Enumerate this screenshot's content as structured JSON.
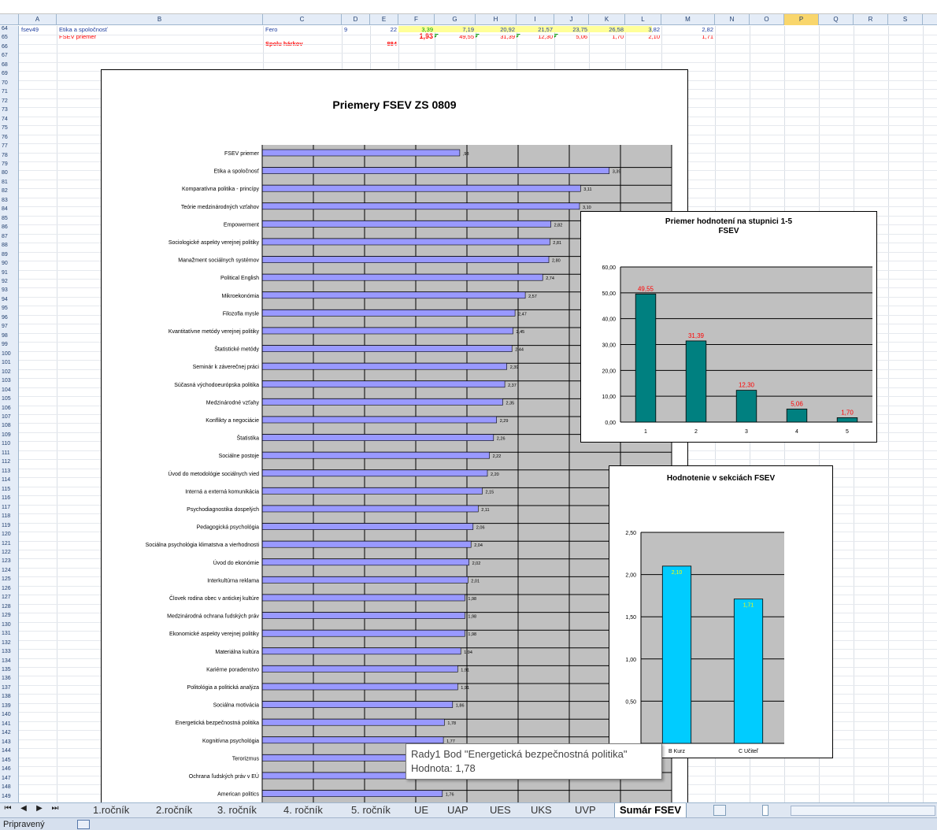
{
  "column_headers": [
    "A",
    "B",
    "C",
    "D",
    "E",
    "F",
    "G",
    "H",
    "I",
    "J",
    "K",
    "L",
    "M",
    "N",
    "O",
    "P",
    "Q",
    "R",
    "S"
  ],
  "selected_column": "P",
  "row_numbers": [
    "64",
    "65",
    "66",
    "67",
    "68",
    "69",
    "70",
    "71",
    "72",
    "73",
    "74",
    "75",
    "76",
    "77",
    "78",
    "79",
    "80",
    "81",
    "82",
    "83",
    "84",
    "85",
    "86",
    "87",
    "88",
    "89",
    "90",
    "91",
    "92",
    "93",
    "94",
    "95",
    "96",
    "97",
    "98",
    "99",
    "100",
    "101",
    "102",
    "103",
    "104",
    "105",
    "106",
    "107",
    "108",
    "109",
    "110",
    "111",
    "112",
    "113",
    "114",
    "115",
    "116",
    "117",
    "118",
    "119",
    "120",
    "121",
    "122",
    "123",
    "124",
    "125",
    "126",
    "127",
    "128",
    "129",
    "130",
    "131",
    "132",
    "133",
    "134",
    "135",
    "136",
    "137",
    "138",
    "139",
    "140",
    "141",
    "142",
    "143",
    "144",
    "145",
    "146",
    "147",
    "148",
    "149"
  ],
  "rows": {
    "r64": {
      "a": "fsev49",
      "b": "Etika a spoločnosť",
      "c": "Fero",
      "d": "9",
      "e": "22",
      "f": "3,39",
      "g": "7,19",
      "h": "20,92",
      "i": "21,57",
      "j": "23,75",
      "k": "26,58",
      "l": "3,82",
      "m": "2,82"
    },
    "r65": {
      "b": "FSEV priemer",
      "f": "1,93",
      "g": "49,55",
      "h": "31,39",
      "i": "12,30",
      "j": "5,06",
      "k": "1,70",
      "l": "2,10",
      "m": "1,71"
    },
    "r66": {
      "c": "Spolu hárkov",
      "e": "884"
    }
  },
  "charts": {
    "main": {
      "title": "Priemery FSEV ZS 0809",
      "chart_data": {
        "type": "bar",
        "orientation": "horizontal",
        "title": "Priemery FSEV ZS 0809",
        "categories": [
          "FSEV priemer",
          "Etika a spoločnosť",
          "Komparatívna politika - princípy",
          "Teórie medzinárodných vzťahov",
          "Empowerment",
          "Sociologické aspekty verejnej politiky",
          "Manažment sociálnych systémov",
          "Political English",
          "Mikroekonómia",
          "Filozofia mysle",
          "Kvantitatívne metódy verejnej politiky",
          "Štatistické metódy",
          "Seminár k záverečnej práci",
          "Súčasná východoeurópska politika",
          "Medzinárodné vzťahy",
          "Konflikty a negociácie",
          "Štatistika",
          "Sociálne postoje",
          "Úvod do metodológie sociálnych vied",
          "Interná a externá komunikácia",
          "Psychodiagnostika dospelých",
          "Pedagogická psychológia",
          "Sociálna psychológia klimatstva a vierhodnosti",
          "Úvod do ekonómie",
          "Interkultúrna reklama",
          "Človek rodina obec v antickej kultúre",
          "Medzinárodná ochrana ľudských práv",
          "Ekonomické aspekty verejnej politiky",
          "Materiálna kultúra",
          "Kariérne poradenstvo",
          "Politológia a politická analýza",
          "Sociálna motivácia",
          "Energetická bezpečnostná politika",
          "Kognitívna psychológia",
          "Terorizmus",
          "Ochrana ľudských práv v EÚ",
          "American politics"
        ],
        "values": [
          1.93,
          3.39,
          3.11,
          3.1,
          2.82,
          2.81,
          2.8,
          2.74,
          2.57,
          2.47,
          2.45,
          2.44,
          2.39,
          2.37,
          2.35,
          2.29,
          2.26,
          2.22,
          2.2,
          2.15,
          2.11,
          2.06,
          2.04,
          2.02,
          2.01,
          1.98,
          1.98,
          1.98,
          1.94,
          1.91,
          1.91,
          1.86,
          1.78,
          1.77,
          1.76,
          1.76,
          1.76
        ],
        "value_labels": [
          ",93",
          "3,39",
          "3,11",
          "3,10",
          "2,82",
          "2,81",
          "2,80",
          "2,74",
          "2,57",
          "2,47",
          "2,45",
          "2,44",
          "2,39",
          "2,37",
          "2,35",
          "2,29",
          "2,26",
          "2,22",
          "2,20",
          "2,15",
          "2,11",
          "2,06",
          "2,04",
          "2,02",
          "2,01",
          "1,98",
          "1,98",
          "1,98",
          "1,94",
          "1,91",
          "1,91",
          "1,86",
          "1,78",
          "1,77",
          "",
          "",
          "1,76"
        ],
        "xlim": [
          0,
          4
        ],
        "bar_color": "#9999ff",
        "plot_bg": "#c0c0c0",
        "grid": true
      }
    },
    "grades": {
      "title_line1": "Priemer hodnotení na stupnici 1-5",
      "title_line2": "FSEV",
      "chart_data": {
        "type": "bar",
        "title": "Priemer hodnotení na stupnici 1-5 FSEV",
        "categories": [
          "1",
          "2",
          "3",
          "4",
          "5"
        ],
        "values": [
          49.55,
          31.39,
          12.3,
          5.06,
          1.7
        ],
        "value_labels": [
          "49,55",
          "31,39",
          "12,30",
          "5,06",
          "1,70"
        ],
        "ylim": [
          0,
          60
        ],
        "yticks": [
          "0,00",
          "10,00",
          "20,00",
          "30,00",
          "40,00",
          "50,00",
          "60,00"
        ],
        "bar_color": "#008080",
        "label_color": "#ff0000",
        "plot_bg": "#c0c0c0",
        "grid": true
      }
    },
    "sections": {
      "title": "Hodnotenie v sekciách FSEV",
      "chart_data": {
        "type": "bar",
        "title": "Hodnotenie v sekciách FSEV",
        "categories": [
          "B Kurz",
          "C Učiteľ"
        ],
        "values": [
          2.1,
          1.71
        ],
        "value_labels": [
          "2,10",
          "1,71"
        ],
        "ylim": [
          0,
          2.5
        ],
        "yticks": [
          "",
          "0,50",
          "1,00",
          "1,50",
          "2,00",
          "2,50"
        ],
        "bar_color": "#00ccff",
        "label_color": "#ffff00",
        "plot_bg": "#c0c0c0",
        "grid": true
      }
    }
  },
  "tooltip": {
    "line1": "Rady1 Bod \"Energetická bezpečnostná politika\"",
    "line2": "Hodnota: 1,78"
  },
  "sheet_tabs": [
    "1.ročník",
    "2.ročník",
    "3. ročník",
    "4. ročník",
    "5. ročník",
    "UE",
    "UAP",
    "UES",
    "UKS",
    "UVP",
    "Sumár FSEV"
  ],
  "active_tab": "Sumár FSEV",
  "nav_buttons": [
    "⏮",
    "◀",
    "▶",
    "⏭"
  ],
  "status_text": "Pripravený"
}
